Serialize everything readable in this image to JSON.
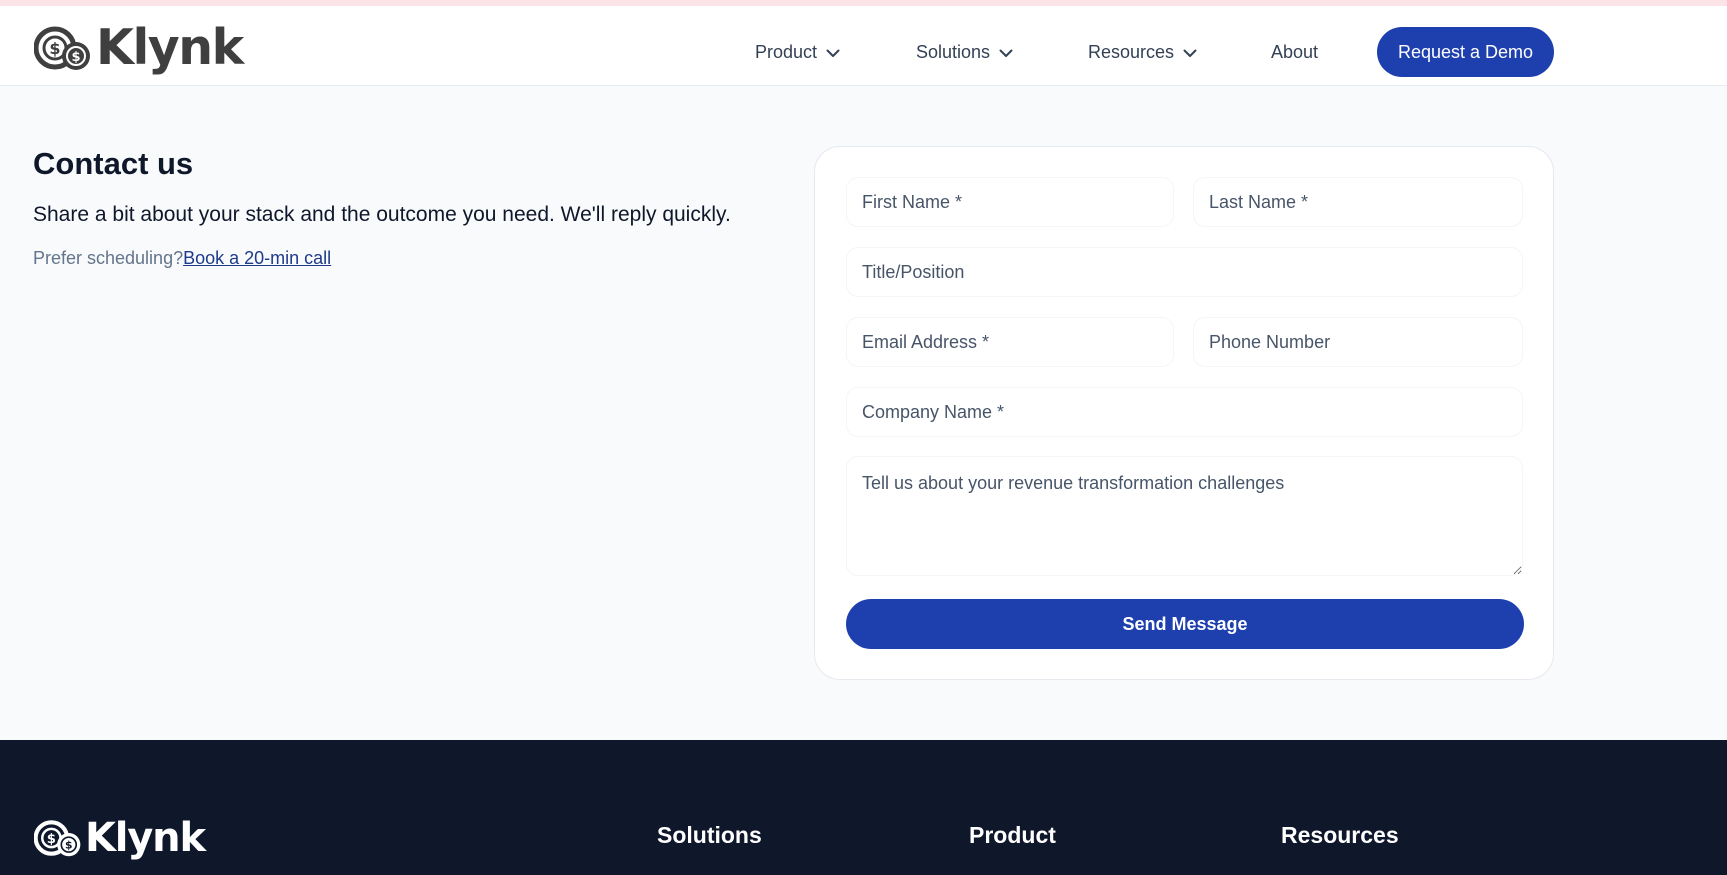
{
  "brand": {
    "name": "Klynk"
  },
  "nav": {
    "items": [
      {
        "label": "Product",
        "has_dropdown": true
      },
      {
        "label": "Solutions",
        "has_dropdown": true
      },
      {
        "label": "Resources",
        "has_dropdown": true
      },
      {
        "label": "About",
        "has_dropdown": false
      }
    ],
    "cta_label": "Request a Demo"
  },
  "contact": {
    "title": "Contact us",
    "subtitle": "Share a bit about your stack and the outcome you need. We'll reply quickly.",
    "prefer_text": "Prefer scheduling?",
    "link_label": "Book a 20-min call"
  },
  "form": {
    "first_name_placeholder": "First Name *",
    "last_name_placeholder": "Last Name *",
    "title_placeholder": "Title/Position",
    "email_placeholder": "Email Address *",
    "phone_placeholder": "Phone Number",
    "company_placeholder": "Company Name *",
    "message_placeholder": "Tell us about your revenue transformation challenges",
    "submit_label": "Send Message"
  },
  "footer": {
    "brand_name": "Klynk",
    "columns": [
      "Solutions",
      "Product",
      "Resources"
    ]
  },
  "colors": {
    "primary": "#1e40af",
    "footer_bg": "#0f172a",
    "page_bg": "#f8fafc"
  }
}
